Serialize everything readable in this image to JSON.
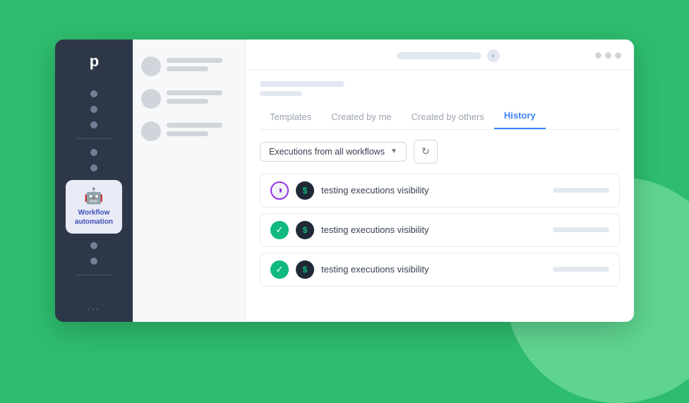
{
  "sidebar": {
    "logo": "p",
    "active_item_label": "Workflow\nautomation",
    "more_dots": "..."
  },
  "topbar": {
    "plus_icon": "+",
    "dots": [
      "dot1",
      "dot2",
      "dot3"
    ]
  },
  "tabs": [
    {
      "id": "templates",
      "label": "Templates",
      "active": false
    },
    {
      "id": "created-by-me",
      "label": "Created by me",
      "active": false
    },
    {
      "id": "created-by-others",
      "label": "Created by others",
      "active": false
    },
    {
      "id": "history",
      "label": "History",
      "active": true
    }
  ],
  "filter": {
    "label": "Executions from all workflows",
    "chevron": "▼"
  },
  "refresh_button_icon": "↻",
  "executions": [
    {
      "id": 1,
      "status": "running",
      "status_char": "◑",
      "service_char": "$",
      "name": "testing executions visibility"
    },
    {
      "id": 2,
      "status": "success",
      "status_char": "✓",
      "service_char": "$",
      "name": "testing executions visibility"
    },
    {
      "id": 3,
      "status": "success",
      "status_char": "✓",
      "service_char": "$",
      "name": "testing executions visibility"
    }
  ],
  "colors": {
    "active_tab": "#3b82f6",
    "success_green": "#10b981",
    "running_purple": "#9333ea",
    "sidebar_bg": "#2d3748",
    "active_item_bg": "#e8eaf6",
    "active_item_label": "#3f51b5"
  }
}
